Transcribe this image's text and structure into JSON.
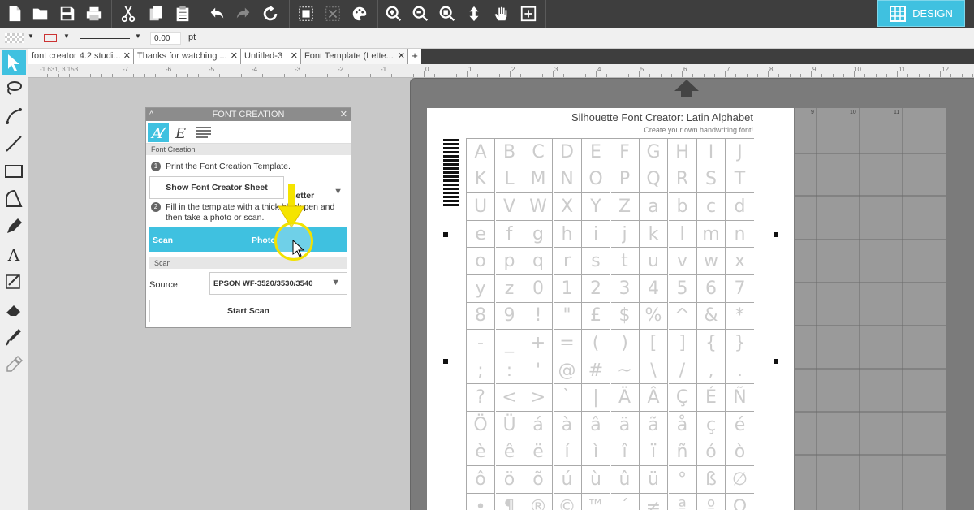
{
  "toolbar": {
    "icons": [
      "new-file-icon",
      "open-folder-icon",
      "save-icon",
      "print-icon",
      "cut-icon",
      "copy-icon",
      "paste-icon",
      "undo-icon",
      "redo-icon",
      "refresh-icon",
      "group-icon",
      "ungroup-icon",
      "palette-icon",
      "zoom-in-icon",
      "zoom-out-icon",
      "zoom-fit-icon",
      "move-icon",
      "pan-icon",
      "add-icon"
    ],
    "design_label": "DESIGN"
  },
  "subbar": {
    "line_width": "0.00",
    "unit": "pt"
  },
  "tabs": [
    {
      "label": "font creator 4.2.studi..."
    },
    {
      "label": "Thanks for watching ..."
    },
    {
      "label": "Untitled-3"
    },
    {
      "label": "Font Template (Lette..."
    }
  ],
  "ruler": {
    "coords": "-1.631, 3.153",
    "labels": [
      "-7",
      "-6",
      "-5",
      "-4",
      "-3",
      "-2",
      "-1",
      "0",
      "1",
      "2",
      "3",
      "4",
      "5",
      "6",
      "7",
      "8",
      "9",
      "10",
      "11",
      "12"
    ]
  },
  "panel": {
    "title": "FONT CREATION",
    "section1": "Font Creation",
    "step1": "Print the Font Creation Template.",
    "show_sheet_button": "Show Font Creator Sheet",
    "paper_size": "Letter",
    "step2": "Fill in the template with a thick black pen and then take a photo or scan.",
    "scan_option": "Scan",
    "photo_option": "Photo",
    "section2": "Scan",
    "source_label": "Source",
    "source_value": "EPSON WF-3520/3530/3540",
    "start_scan_button": "Start Scan"
  },
  "sheet": {
    "title": "Silhouette Font Creator: Latin Alphabet",
    "subtitle": "Create your own handwriting font!",
    "mat_labels": [
      "9",
      "10",
      "11"
    ],
    "glyphs": [
      [
        "A",
        "B",
        "C",
        "D",
        "E",
        "F",
        "G",
        "H",
        "I",
        "J"
      ],
      [
        "K",
        "L",
        "M",
        "N",
        "O",
        "P",
        "Q",
        "R",
        "S",
        "T"
      ],
      [
        "U",
        "V",
        "W",
        "X",
        "Y",
        "Z",
        "a",
        "b",
        "c",
        "d"
      ],
      [
        "e",
        "f",
        "g",
        "h",
        "i",
        "j",
        "k",
        "l",
        "m",
        "n"
      ],
      [
        "o",
        "p",
        "q",
        "r",
        "s",
        "t",
        "u",
        "v",
        "w",
        "x"
      ],
      [
        "y",
        "z",
        "0",
        "1",
        "2",
        "3",
        "4",
        "5",
        "6",
        "7"
      ],
      [
        "8",
        "9",
        "!",
        "\"",
        "£",
        "$",
        "%",
        "^",
        "&",
        "*"
      ],
      [
        "-",
        "_",
        "+",
        "=",
        "(",
        ")",
        "[",
        "]",
        "{",
        "}"
      ],
      [
        ";",
        ":",
        "'",
        "@",
        "#",
        "~",
        "\\",
        "/",
        ",",
        "."
      ],
      [
        "?",
        "<",
        ">",
        "`",
        "|",
        "Ä",
        "Â",
        "Ç",
        "É",
        "Ñ"
      ],
      [
        "Ö",
        "Ü",
        "á",
        "à",
        "â",
        "ä",
        "ã",
        "å",
        "ç",
        "é"
      ],
      [
        "è",
        "ê",
        "ë",
        "í",
        "ì",
        "î",
        "ï",
        "ñ",
        "ó",
        "ò"
      ],
      [
        "ô",
        "ö",
        "õ",
        "ú",
        "ù",
        "û",
        "ü",
        "°",
        "ß",
        "∅"
      ],
      [
        "•",
        "¶",
        "®",
        "©",
        "™",
        "´",
        "≠",
        "ª",
        "º",
        "Ω"
      ]
    ]
  }
}
